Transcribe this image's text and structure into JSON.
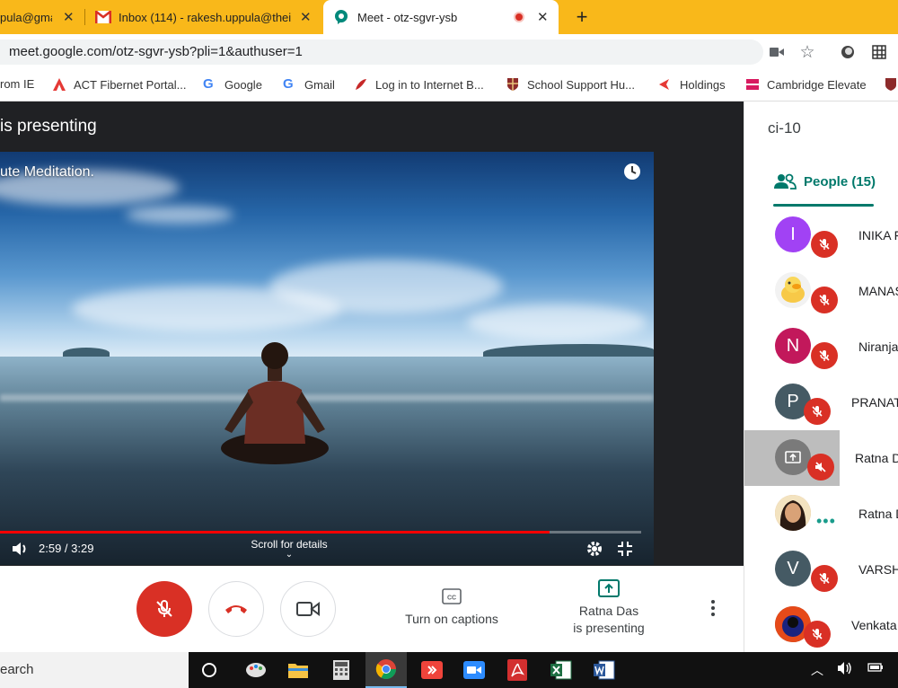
{
  "browser": {
    "tabs": [
      {
        "label": "pula@gmai",
        "active": false
      },
      {
        "label": "Inbox (114) - rakesh.uppula@thei",
        "active": false
      },
      {
        "label": "Meet - otz-sgvr-ysb",
        "active": true
      }
    ],
    "url": "meet.google.com/otz-sgvr-ysb?pli=1&authuser=1",
    "bookmarks": [
      "rom IE",
      "ACT Fibernet Portal...",
      "Google",
      "Gmail",
      "Log in to Internet B...",
      "School Support Hu...",
      "Holdings",
      "Cambridge Elevate"
    ]
  },
  "meet": {
    "presenting_banner": "is presenting",
    "video": {
      "title": "ute Meditation.",
      "time": "2:59 / 3:29",
      "progress": 0.857,
      "scroll_hint": "Scroll for details"
    },
    "controls": {
      "captions_label": "Turn on captions",
      "presenter_line1": "Ratna Das",
      "presenter_line2": "is presenting"
    },
    "panel": {
      "meeting_code": "ci-10",
      "people_tab": "People (15)",
      "participants": [
        {
          "name": "INIKA F",
          "initial": "I",
          "color": "#a142f4",
          "status": "muted"
        },
        {
          "name": "MANAS",
          "initial": "",
          "color": "#f2f2f2",
          "status": "muted"
        },
        {
          "name": "Niranja",
          "initial": "N",
          "color": "#c2185b",
          "status": "muted"
        },
        {
          "name": "PRANAT",
          "initial": "P",
          "color": "#455a64",
          "status": "muted"
        },
        {
          "name": "Ratna D",
          "initial": "",
          "color": "#7a7a7a",
          "status": "muted"
        },
        {
          "name": "Ratna D",
          "initial": "",
          "color": "#d8a06a",
          "status": "speaking"
        },
        {
          "name": "VARSH",
          "initial": "V",
          "color": "#455a64",
          "status": "muted"
        },
        {
          "name": "Venkata",
          "initial": "",
          "color": "#8a3b2a",
          "status": "muted"
        }
      ]
    }
  },
  "taskbar": {
    "search_text": "earch"
  }
}
